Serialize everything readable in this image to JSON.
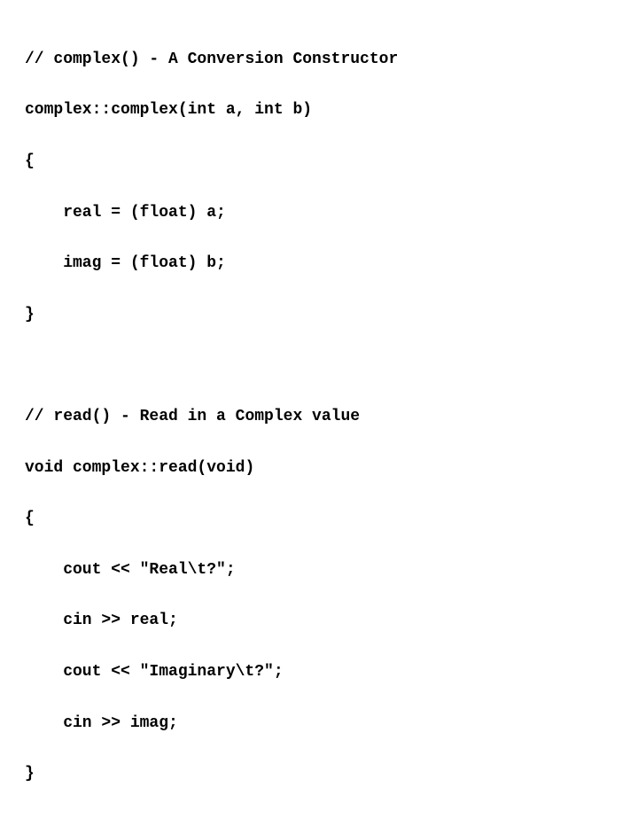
{
  "code": {
    "line1": "// complex() - A Conversion Constructor",
    "line2": "complex::complex(int a, int b)",
    "line3": "{",
    "line4": "real = (float) a;",
    "line5": "imag = (float) b;",
    "line6": "}",
    "line7": "",
    "line8": "// read() - Read in a Complex value",
    "line9": "void complex::read(void)",
    "line10": "{",
    "line11": "cout << \"Real\\t?\";",
    "line12": "cin >> real;",
    "line13": "cout << \"Imaginary\\t?\";",
    "line14": "cin >> imag;",
    "line15": "}"
  }
}
